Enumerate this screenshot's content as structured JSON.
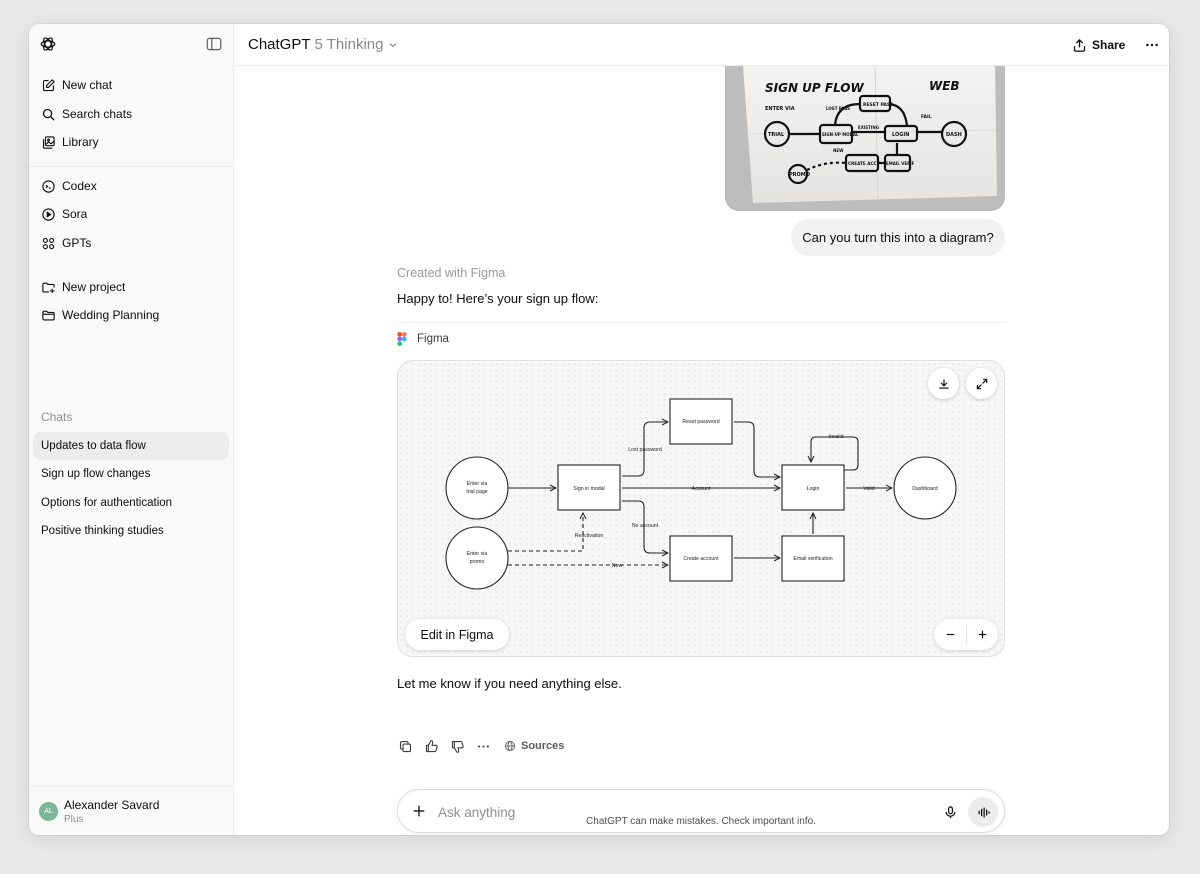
{
  "sidebar": {
    "logo_icon": "openai-logo-icon",
    "toggle_icon": "sidebar-toggle-icon",
    "primary_items": [
      {
        "label": "New chat",
        "icon": "edit-icon"
      },
      {
        "label": "Search chats",
        "icon": "search-icon"
      },
      {
        "label": "Library",
        "icon": "library-icon"
      }
    ],
    "secondary_items": [
      {
        "label": "Codex",
        "icon": "codex-icon"
      },
      {
        "label": "Sora",
        "icon": "sora-icon"
      },
      {
        "label": "GPTs",
        "icon": "gpts-icon"
      }
    ],
    "project_items": [
      {
        "label": "New project",
        "icon": "new-folder-icon"
      },
      {
        "label": "Wedding Planning",
        "icon": "folder-icon"
      }
    ],
    "chats_heading": "Chats",
    "chats": [
      {
        "label": "Updates to data flow",
        "active": true
      },
      {
        "label": "Sign up flow changes",
        "active": false
      },
      {
        "label": "Options for authentication",
        "active": false
      },
      {
        "label": "Positive thinking studies",
        "active": false
      }
    ],
    "user": {
      "initials": "AL",
      "name": "Alexander Savard",
      "plan": "Plus",
      "avatar_color": "#7cb69b"
    }
  },
  "header": {
    "model_name": "ChatGPT",
    "model_variant": "5 Thinking",
    "share_label": "Share"
  },
  "conversation": {
    "napkin_sketch": {
      "title": "SIGN UP FLOW",
      "corner": "WEB",
      "labels": [
        "ENTER VIA",
        "TRIAL",
        "PROMO",
        "SIGN-UP MODAL",
        "RESET PASS",
        "LOGIN",
        "DASH",
        "CREATE ACCT",
        "EMAIL VERIF",
        "LOST PASS",
        "EXISTING",
        "FAIL",
        "NEW"
      ]
    },
    "user_message": "Can you turn this into a diagram?",
    "created_with": "Created with Figma",
    "assistant_reply": "Happy to! Here’s your sign up flow:",
    "figma_label": "Figma",
    "diagram": {
      "nodes": {
        "enter_trial": "Enter via trial page",
        "enter_promo": "Enter via promo",
        "sign_in_modal": "Sign in modal",
        "reset_password": "Reset password",
        "login": "Login",
        "dashboard": "Dashboard",
        "create_account": "Create account",
        "email_verification": "Email verification"
      },
      "edges": {
        "lost_password": "Lost password",
        "account": "Account",
        "no_account": "No account",
        "reactivation": "Reactivation",
        "new": "New",
        "invalid": "Invalid",
        "valid": "Valid"
      }
    },
    "edit_in_figma": "Edit in Figma",
    "followup": "Let me know if you need anything else.",
    "sources_label": "Sources"
  },
  "composer": {
    "placeholder": "Ask anything",
    "disclaimer": "ChatGPT can make mistakes. Check important info."
  }
}
